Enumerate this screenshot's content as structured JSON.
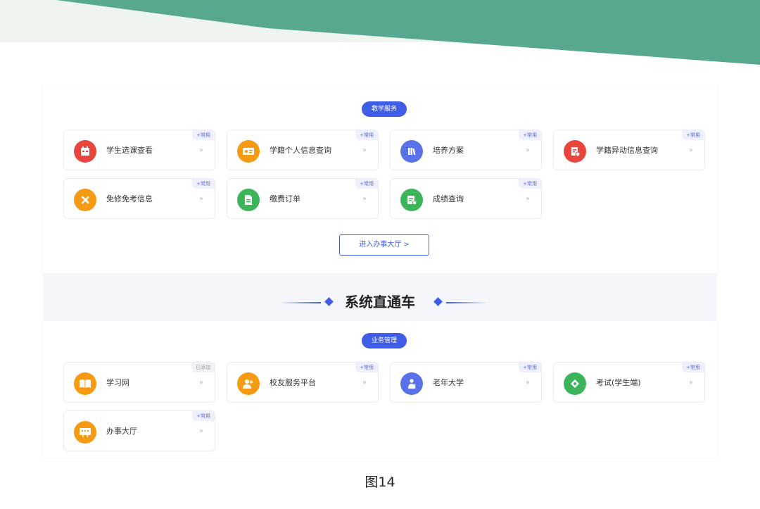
{
  "section1": {
    "pill": "教学服务",
    "cards": [
      {
        "label": "学生选课查看",
        "tag": "+常用",
        "icon": "calendar-icon",
        "color": "#e8453c"
      },
      {
        "label": "学籍个人信息查询",
        "tag": "+常用",
        "icon": "id-card-icon",
        "color": "#f59a12"
      },
      {
        "label": "培养方案",
        "tag": "+常用",
        "icon": "books-icon",
        "color": "#5a72e8"
      },
      {
        "label": "学籍异动信息查询",
        "tag": "+常用",
        "icon": "document-change-icon",
        "color": "#e8453c"
      },
      {
        "label": "免修免考信息",
        "tag": "+常用",
        "icon": "tools-icon",
        "color": "#f59a12"
      },
      {
        "label": "缴费订单",
        "tag": "+常用",
        "icon": "order-doc-icon",
        "color": "#3cb55a"
      },
      {
        "label": "成绩查询",
        "tag": "+常用",
        "icon": "grade-sheet-icon",
        "color": "#3cb55a"
      }
    ],
    "button": "进入办事大厅 >"
  },
  "section_title": "系统直通车",
  "section2": {
    "pill": "业务管理",
    "cards": [
      {
        "label": "学习网",
        "tag": "已添加",
        "icon": "book-icon",
        "color": "#f59a12"
      },
      {
        "label": "校友服务平台",
        "tag": "+常用",
        "icon": "alumni-icon",
        "color": "#f59a12"
      },
      {
        "label": "老年大学",
        "tag": "+常用",
        "icon": "elder-person-icon",
        "color": "#5a72e8"
      },
      {
        "label": "考试(学生端)",
        "tag": "+常用",
        "icon": "exam-icon",
        "color": "#3cb55a"
      },
      {
        "label": "办事大厅",
        "tag": "+常用",
        "icon": "service-hall-icon",
        "color": "#f59a12"
      }
    ]
  },
  "arrow_glyph": "»",
  "caption": "图14"
}
